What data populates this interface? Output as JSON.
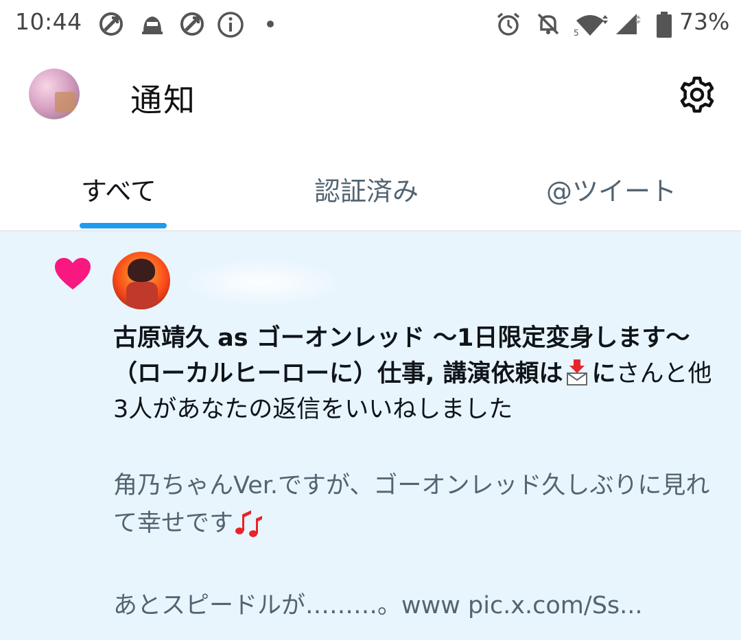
{
  "status_bar": {
    "time": "10:44",
    "battery_percent": "73%",
    "icons": [
      "app-notification-icon",
      "robot-icon",
      "app-notification-icon",
      "info-icon",
      "dot-icon",
      "alarm-icon",
      "mute-icon",
      "wifi-icon",
      "signal-icon",
      "battery-icon"
    ]
  },
  "header": {
    "title": "通知",
    "settings_icon": "gear-icon"
  },
  "tabs": [
    {
      "label": "すべて",
      "active": true
    },
    {
      "label": "認証済み",
      "active": false
    },
    {
      "label": "@ツイート",
      "active": false
    }
  ],
  "notification": {
    "type_icon": "heart-icon",
    "actor_name_part1": "古原靖久 as ゴーオンレッド 〜1日限定変身します〜（ローカルヒーローに）仕事, 講演依頼は",
    "actor_name_part2": "に",
    "action_text": "さんと他3人があなたの返信をいいねしました",
    "reply_text": "角乃ちゃんVer.ですが、ゴーオンレッド久しぶりに見れて幸せです",
    "reply_more": "あとスピードルが………。www pic.x.com/Ss..."
  },
  "colors": {
    "accent": "#1d9bf0",
    "like": "#f91880",
    "highlight_bg": "#e8f5fd",
    "secondary_text": "#536471"
  }
}
